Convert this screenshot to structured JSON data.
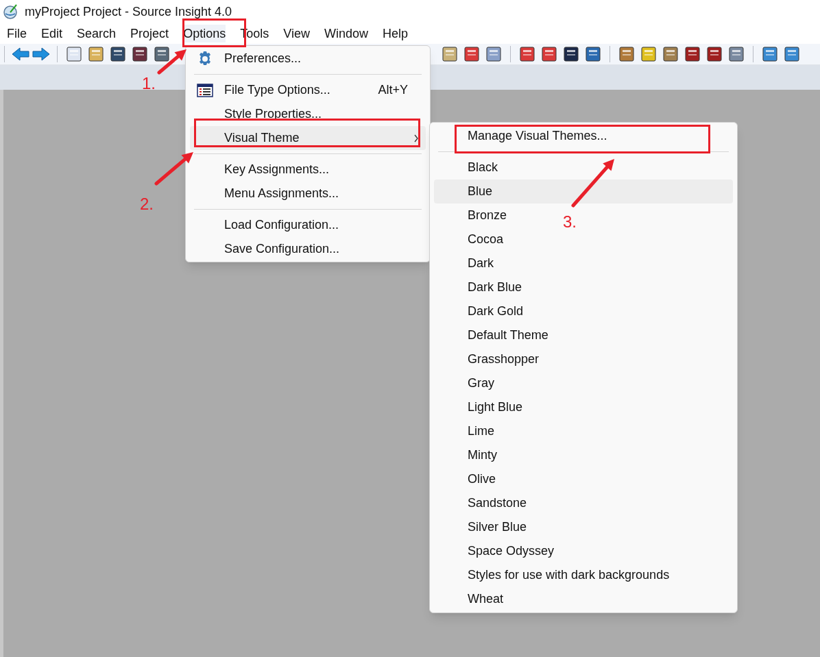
{
  "window": {
    "title": "myProject Project - Source Insight 4.0"
  },
  "menubar": [
    {
      "label": "File",
      "selected": false
    },
    {
      "label": "Edit",
      "selected": false
    },
    {
      "label": "Search",
      "selected": false
    },
    {
      "label": "Project",
      "selected": false
    },
    {
      "label": "Options",
      "selected": true
    },
    {
      "label": "Tools",
      "selected": false
    },
    {
      "label": "View",
      "selected": false
    },
    {
      "label": "Window",
      "selected": false
    },
    {
      "label": "Help",
      "selected": false
    }
  ],
  "options_menu": [
    {
      "kind": "item",
      "label": "Preferences...",
      "selected": false
    },
    {
      "kind": "separator"
    },
    {
      "kind": "item",
      "label": "File Type Options...",
      "shortcut": "Alt+Y",
      "selected": false
    },
    {
      "kind": "item",
      "label": "Style Properties...",
      "selected": false
    },
    {
      "kind": "submenu",
      "label": "Visual Theme",
      "selected": true
    },
    {
      "kind": "separator"
    },
    {
      "kind": "item",
      "label": "Key Assignments...",
      "selected": false
    },
    {
      "kind": "item",
      "label": "Menu Assignments...",
      "selected": false
    },
    {
      "kind": "separator"
    },
    {
      "kind": "item",
      "label": "Load Configuration...",
      "selected": false
    },
    {
      "kind": "item",
      "label": "Save Configuration...",
      "selected": false
    }
  ],
  "visual_theme_menu": [
    {
      "kind": "item",
      "label": "Manage Visual Themes...",
      "selected": false
    },
    {
      "kind": "separator"
    },
    {
      "kind": "item",
      "label": "Black",
      "selected": false
    },
    {
      "kind": "item",
      "label": "Blue",
      "selected": true
    },
    {
      "kind": "item",
      "label": "Bronze",
      "selected": false
    },
    {
      "kind": "item",
      "label": "Cocoa",
      "selected": false
    },
    {
      "kind": "item",
      "label": "Dark",
      "selected": false
    },
    {
      "kind": "item",
      "label": "Dark Blue",
      "selected": false
    },
    {
      "kind": "item",
      "label": "Dark Gold",
      "selected": false
    },
    {
      "kind": "item",
      "label": "Default Theme",
      "selected": false
    },
    {
      "kind": "item",
      "label": "Grasshopper",
      "selected": false
    },
    {
      "kind": "item",
      "label": "Gray",
      "selected": false
    },
    {
      "kind": "item",
      "label": "Light Blue",
      "selected": false
    },
    {
      "kind": "item",
      "label": "Lime",
      "selected": false
    },
    {
      "kind": "item",
      "label": "Minty",
      "selected": false
    },
    {
      "kind": "item",
      "label": "Olive",
      "selected": false
    },
    {
      "kind": "item",
      "label": "Sandstone",
      "selected": false
    },
    {
      "kind": "item",
      "label": "Silver Blue",
      "selected": false
    },
    {
      "kind": "item",
      "label": "Space Odyssey",
      "selected": false
    },
    {
      "kind": "item",
      "label": "Styles for use with dark backgrounds",
      "selected": false
    },
    {
      "kind": "item",
      "label": "Wheat",
      "selected": false
    }
  ],
  "annotations": [
    {
      "label": "1."
    },
    {
      "label": "2."
    },
    {
      "label": "3."
    }
  ]
}
